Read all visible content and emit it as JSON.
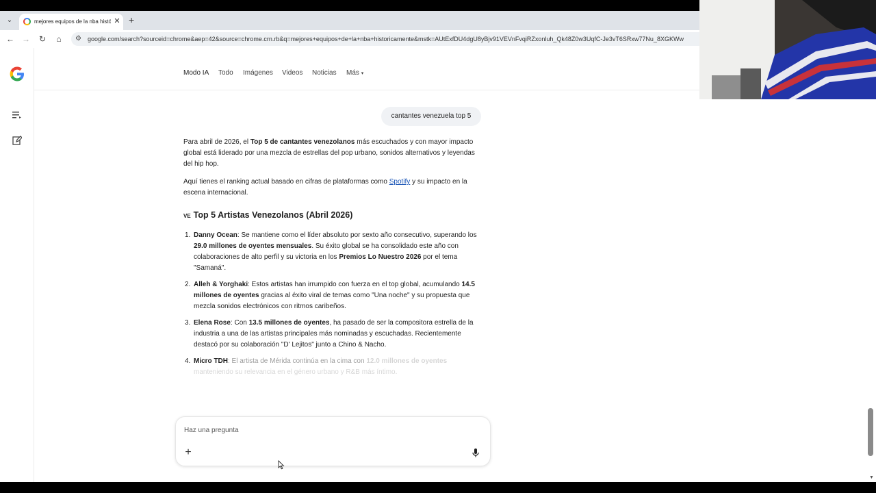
{
  "browser": {
    "tab_title": "mejores equipos de la nba histó",
    "tab_close": "✕",
    "new_tab": "+",
    "tab_menu": "⌄",
    "url": "google.com/search?sourceid=chrome&aep=42&source=chrome.crn.rb&q=mejores+equipos+de+la+nba+historicamente&mstk=AUtExfDU4dgU8yBjv91VEVnFvqiRZxonluh_Qk48Z0w3UqfC-Je3vT6SRxw77Nu_8XGKWw",
    "back": "←",
    "forward": "→",
    "reload": "↻",
    "home": "⌂"
  },
  "search_tabs": [
    "Modo IA",
    "Todo",
    "Imágenes",
    "Videos",
    "Noticias",
    "Más"
  ],
  "more_caret": "▾",
  "user_query": "cantantes venezuela top 5",
  "answer": {
    "intro": {
      "p1": "Para abril de 2026, el ",
      "b1": "Top 5 de cantantes venezolanos",
      "p2": " más escuchados y con mayor impacto global está liderado por una mezcla de estrellas del pop urbano, sonidos alternativos y leyendas del hip hop."
    },
    "ranking_note": {
      "p1": "Aquí tienes el ranking actual basado en cifras de plataformas como ",
      "link": "Spotify",
      "p2": " y su impacto en la escena internacional."
    },
    "heading_flag": "VE",
    "heading": "Top 5 Artistas Venezolanos (Abril 2026)",
    "items": [
      {
        "num": "1.",
        "name": "Danny Ocean",
        "t1": ": Se mantiene como el líder absoluto por sexto año consecutivo, superando los ",
        "b1": "29.0 millones de oyentes mensuales",
        "t2": ". Su éxito global se ha consolidado este año con colaboraciones de alto perfil y su victoria en los ",
        "b2": "Premios Lo Nuestro 2026",
        "t3": " por el tema \"Samaná\"."
      },
      {
        "num": "2.",
        "name": "Alleh & Yorghaki",
        "t1": ": Estos artistas han irrumpido con fuerza en el top global, acumulando ",
        "b1": "14.5 millones de oyentes",
        "t2": " gracias al éxito viral de temas como \"Una noche\" y su propuesta que mezcla sonidos electrónicos con ritmos caribeños."
      },
      {
        "num": "3.",
        "name": "Elena Rose",
        "t1": ": Con ",
        "b1": "13.5 millones de oyentes",
        "t2": ", ha pasado de ser la compositora estrella de la industria a una de las artistas principales más nominadas y escuchadas. Recientemente destacó por su colaboración \"D' Lejitos\" junto a Chino & Nacho."
      },
      {
        "num": "4.",
        "name": "Micro TDH",
        "t1": ": El artista de Mérida continúa en la cima con ",
        "b1": "12.0 millones de oyentes",
        "t2": " manteniendo su relevancia en el género urbano y R&B más íntimo."
      }
    ]
  },
  "ask": {
    "placeholder": "Haz una pregunta",
    "plus": "+"
  },
  "colors": {
    "link": "#1a55b6",
    "bubble": "#f0f2f5"
  }
}
